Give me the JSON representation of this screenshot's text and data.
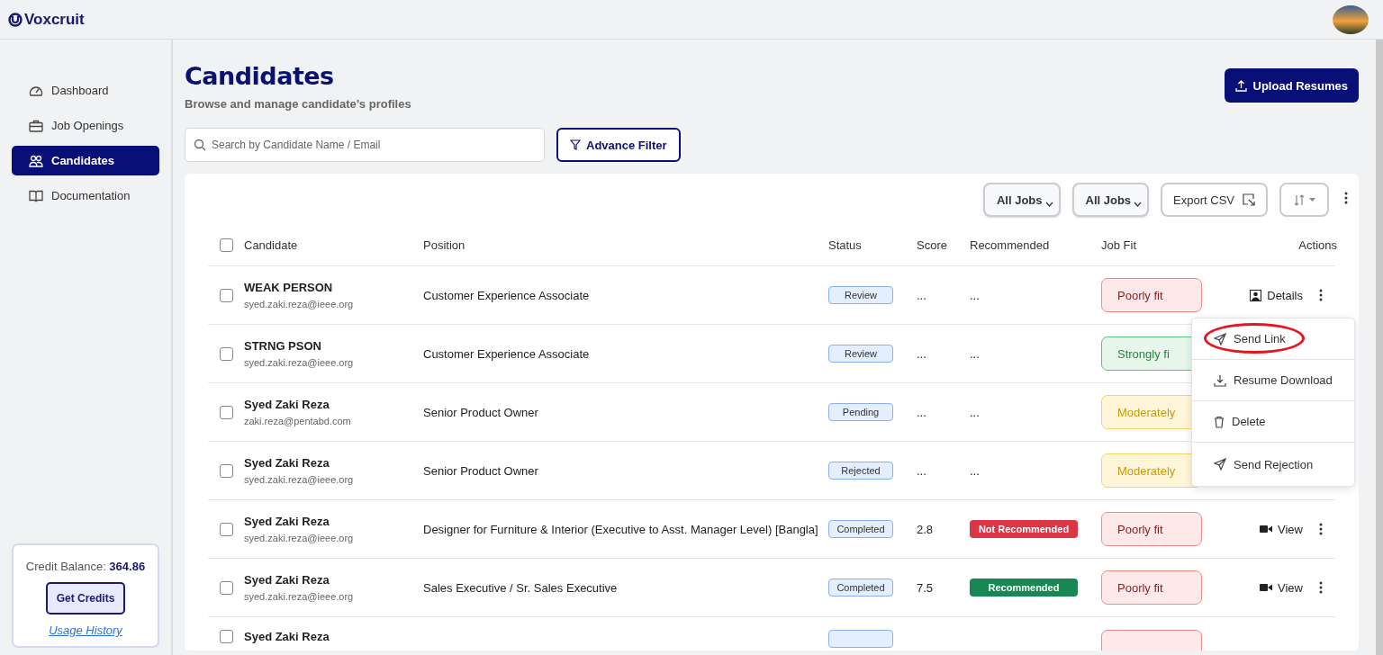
{
  "brand": {
    "name": "Voxcruit"
  },
  "sidebar": {
    "items": [
      {
        "label": "Dashboard",
        "selected": false
      },
      {
        "label": "Job Openings",
        "selected": false
      },
      {
        "label": "Candidates",
        "selected": true
      },
      {
        "label": "Documentation",
        "selected": false
      }
    ],
    "credit": {
      "label": "Credit Balance:",
      "value": "364.86",
      "button": "Get Credits",
      "link": "Usage History"
    }
  },
  "header": {
    "title": "Candidates",
    "subtitle": "Browse and manage candidate’s profiles",
    "upload_button": "Upload Resumes"
  },
  "search": {
    "placeholder": "Search by Candidate Name / Email"
  },
  "filter_button": "Advance Filter",
  "toolbar": {
    "dropdowns": [
      "All Jobs",
      "All Jobs"
    ],
    "export_button": "Export CSV"
  },
  "table": {
    "select_all": {
      "checked": false
    },
    "columns": [
      "Candidate",
      "Position",
      "Status",
      "Score",
      "Recommended",
      "Job Fit",
      "Actions"
    ],
    "rows": [
      {
        "checked": false,
        "name": "WEAK PERSON",
        "email": "syed.zaki.reza@ieee.org",
        "position": "Customer Experience Associate",
        "status": "Review",
        "score": "...",
        "recommended": {
          "kind": "none",
          "text": "..."
        },
        "job_fit": {
          "kind": "poor",
          "text": "Poorly fit"
        },
        "action": {
          "kind": "details",
          "label": "Details"
        }
      },
      {
        "checked": false,
        "name": "STRNG PSON",
        "email": "syed.zaki.reza@ieee.org",
        "position": "Customer Experience Associate",
        "status": "Review",
        "score": "...",
        "recommended": {
          "kind": "none",
          "text": "..."
        },
        "job_fit": {
          "kind": "strong",
          "text": "Strongly fi"
        }
      },
      {
        "checked": false,
        "name": "Syed Zaki Reza",
        "email": "zaki.reza@pentabd.com",
        "position": "Senior Product Owner",
        "status": "Pending",
        "score": "...",
        "recommended": {
          "kind": "none",
          "text": "..."
        },
        "job_fit": {
          "kind": "moderate",
          "text": "Moderately"
        }
      },
      {
        "checked": false,
        "name": "Syed Zaki Reza",
        "email": "syed.zaki.reza@ieee.org",
        "position": "Senior Product Owner",
        "status": "Rejected",
        "score": "...",
        "recommended": {
          "kind": "none",
          "text": "..."
        },
        "job_fit": {
          "kind": "moderate",
          "text": "Moderately"
        }
      },
      {
        "checked": false,
        "name": "Syed Zaki Reza",
        "email": "syed.zaki.reza@ieee.org",
        "position": "Designer for Furniture & Interior (Executive to Asst. Manager Level) [Bangla]",
        "status": "Completed",
        "score": "2.8",
        "recommended": {
          "kind": "not_recommended",
          "text": "Not Recommended"
        },
        "job_fit": {
          "kind": "poor",
          "text": "Poorly fit"
        },
        "action": {
          "kind": "view",
          "label": "View"
        }
      },
      {
        "checked": false,
        "name": "Syed Zaki Reza",
        "email": "syed.zaki.reza@ieee.org",
        "position": "Sales Executive / Sr. Sales Executive",
        "status": "Completed",
        "score": "7.5",
        "recommended": {
          "kind": "recommended",
          "text": "Recommended"
        },
        "job_fit": {
          "kind": "poor",
          "text": "Poorly fit"
        },
        "action": {
          "kind": "view",
          "label": "View"
        }
      },
      {
        "checked": false,
        "name": "Syed Zaki Reza",
        "job_fit": {
          "kind": "poor"
        }
      }
    ]
  },
  "row_menu": {
    "items": [
      {
        "label": "Send Link",
        "highlighted": true
      },
      {
        "label": "Resume Download",
        "highlighted": false
      },
      {
        "label": "Delete",
        "highlighted": false
      },
      {
        "label": "Send Rejection",
        "highlighted": false
      }
    ]
  }
}
